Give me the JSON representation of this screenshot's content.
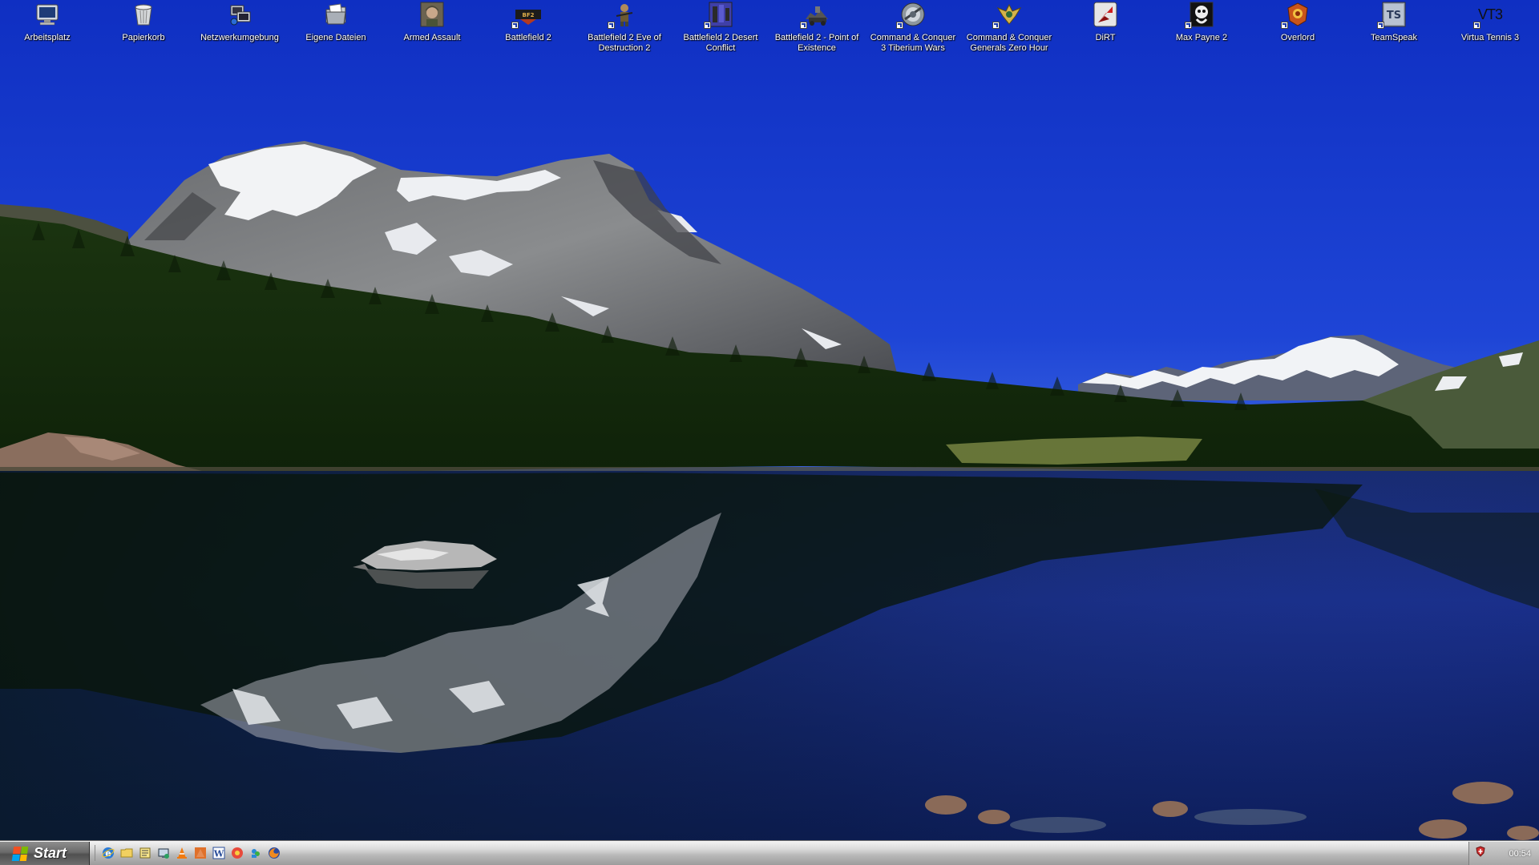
{
  "desktop": {
    "icons": [
      {
        "label": "Arbeitsplatz",
        "icon": "computer-icon",
        "shortcut": false
      },
      {
        "label": "Papierkorb",
        "icon": "recycle-bin-icon",
        "shortcut": false
      },
      {
        "label": "Netzwerkumgebung",
        "icon": "network-icon",
        "shortcut": false
      },
      {
        "label": "Eigene Dateien",
        "icon": "documents-folder-icon",
        "shortcut": false
      },
      {
        "label": "Armed Assault",
        "icon": "armed-assault-icon",
        "shortcut": false
      },
      {
        "label": "Battlefield 2",
        "icon": "battlefield2-icon",
        "shortcut": true
      },
      {
        "label": "Battlefield 2 Eve of Destruction 2",
        "icon": "battlefield2-eod-icon",
        "shortcut": true
      },
      {
        "label": "Battlefield 2 Desert Conflict",
        "icon": "battlefield2-desert-icon",
        "shortcut": true
      },
      {
        "label": "Battlefield 2 - Point of Existence",
        "icon": "battlefield2-poe-icon",
        "shortcut": true
      },
      {
        "label": "Command & Conquer 3 Tiberium Wars",
        "icon": "cnc3-icon",
        "shortcut": true
      },
      {
        "label": "Command & Conquer Generals Zero Hour",
        "icon": "cnc-generals-icon",
        "shortcut": true
      },
      {
        "label": "DiRT",
        "icon": "dirt-icon",
        "shortcut": false
      },
      {
        "label": "Max Payne 2",
        "icon": "max-payne2-icon",
        "shortcut": true
      },
      {
        "label": "Overlord",
        "icon": "overlord-icon",
        "shortcut": true
      },
      {
        "label": "TeamSpeak",
        "icon": "teamspeak-icon",
        "shortcut": true
      },
      {
        "label": "Virtua Tennis 3",
        "icon": "virtua-tennis3-icon",
        "shortcut": true,
        "glyph_text": "VT3"
      }
    ]
  },
  "taskbar": {
    "start_label": "Start",
    "quick_launch": [
      {
        "icon": "internet-explorer-icon"
      },
      {
        "icon": "folder-icon"
      },
      {
        "icon": "notepad-icon"
      },
      {
        "icon": "network-places-icon"
      },
      {
        "icon": "vlc-icon"
      },
      {
        "icon": "firefox-icon"
      },
      {
        "icon": "word-icon"
      },
      {
        "icon": "media-icon"
      },
      {
        "icon": "messenger-icon"
      },
      {
        "icon": "firefox-browser-icon"
      }
    ],
    "tray": {
      "clock": "00:54",
      "tray_icon": "antivirus-shield-icon"
    }
  },
  "colors": {
    "sky": "#1d3bc4",
    "taskbar_light": "#f4f4f4",
    "taskbar_dark": "#9c9c9c",
    "start_button": "#6a6a6a"
  }
}
